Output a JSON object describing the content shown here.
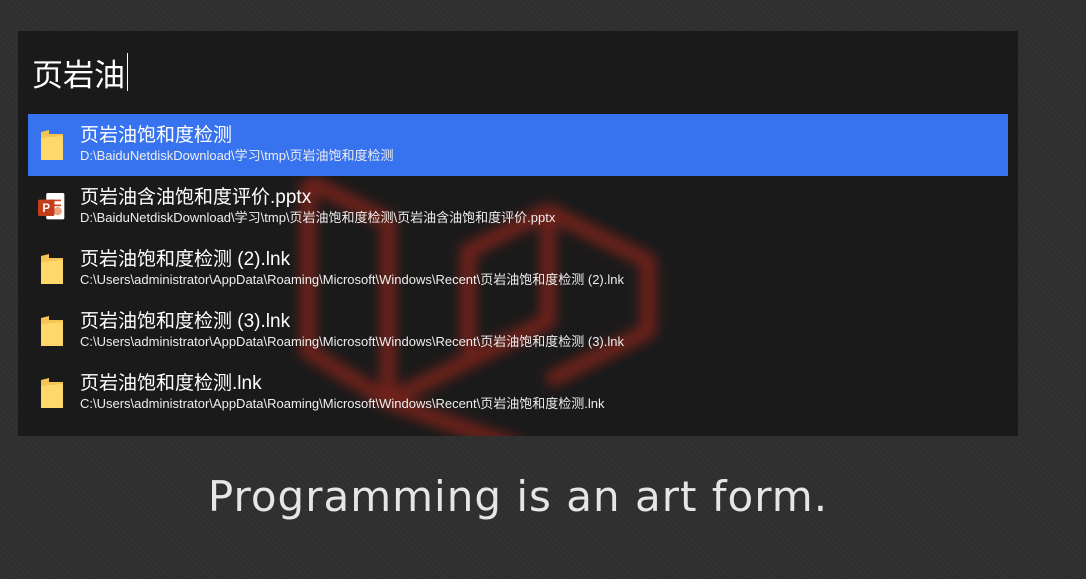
{
  "search": {
    "query": "页岩油"
  },
  "results": [
    {
      "title": "页岩油饱和度检测",
      "path": "D:\\BaiduNetdiskDownload\\学习\\tmp\\页岩油饱和度检测",
      "icon": "folder-icon",
      "selected": true
    },
    {
      "title": "页岩油含油饱和度评价.pptx",
      "path": "D:\\BaiduNetdiskDownload\\学习\\tmp\\页岩油饱和度检测\\页岩油含油饱和度评价.pptx",
      "icon": "powerpoint-icon",
      "selected": false
    },
    {
      "title": "页岩油饱和度检测 (2).lnk",
      "path": "C:\\Users\\administrator\\AppData\\Roaming\\Microsoft\\Windows\\Recent\\页岩油饱和度检测 (2).lnk",
      "icon": "folder-icon",
      "selected": false
    },
    {
      "title": "页岩油饱和度检测 (3).lnk",
      "path": "C:\\Users\\administrator\\AppData\\Roaming\\Microsoft\\Windows\\Recent\\页岩油饱和度检测 (3).lnk",
      "icon": "folder-icon",
      "selected": false
    },
    {
      "title": "页岩油饱和度检测.lnk",
      "path": "C:\\Users\\administrator\\AppData\\Roaming\\Microsoft\\Windows\\Recent\\页岩油饱和度检测.lnk",
      "icon": "folder-icon",
      "selected": false
    }
  ],
  "wallpaper": {
    "slogan": "Programming is an art form."
  },
  "colors": {
    "selection": "#3873ef",
    "panel": "#1a1a1a",
    "background": "#2f2f2f",
    "watermark": "#c0392b"
  }
}
